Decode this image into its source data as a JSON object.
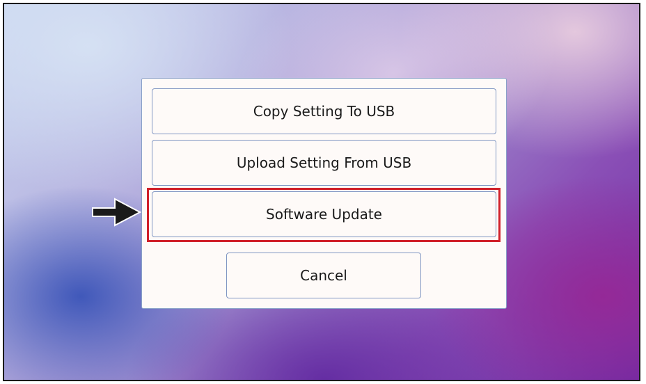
{
  "dialog": {
    "buttons": {
      "copy_setting": "Copy Setting To USB",
      "upload_setting": "Upload Setting From USB",
      "software_update": "Software Update",
      "cancel": "Cancel"
    }
  },
  "annotation": {
    "highlight_color": "#d0202a",
    "pointer_icon": "right-arrow-icon",
    "highlighted_item": "software-update-button"
  }
}
